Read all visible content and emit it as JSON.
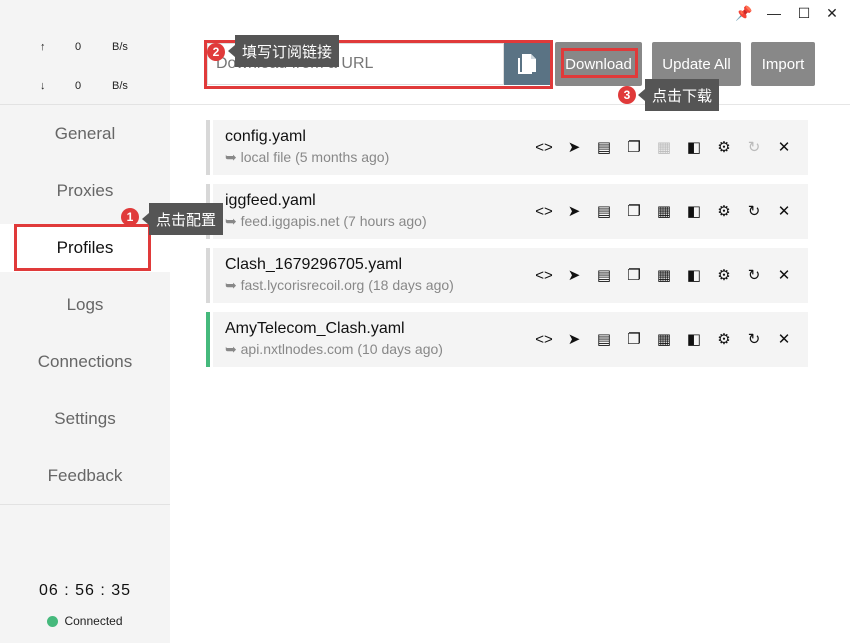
{
  "window": {
    "pin": "📌",
    "minimize": "—",
    "maximize": "☐",
    "close": "✕"
  },
  "traffic": {
    "up": {
      "arrow": "↑",
      "value": "0",
      "unit": "B/s"
    },
    "down": {
      "arrow": "↓",
      "value": "0",
      "unit": "B/s"
    }
  },
  "sidebar": {
    "items": [
      {
        "label": "General"
      },
      {
        "label": "Proxies"
      },
      {
        "label": "Profiles"
      },
      {
        "label": "Logs"
      },
      {
        "label": "Connections"
      },
      {
        "label": "Settings"
      },
      {
        "label": "Feedback"
      }
    ],
    "active": "Profiles",
    "clock": "06 : 56 : 35",
    "status": "Connected",
    "status_color": "#45b97c"
  },
  "header": {
    "url_placeholder": "Download from a URL",
    "download_label": "Download",
    "update_all_label": "Update All",
    "import_label": "Import"
  },
  "annotations": [
    {
      "number": "1",
      "text": "点击配置"
    },
    {
      "number": "2",
      "text": "填写订阅链接"
    },
    {
      "number": "3",
      "text": "点击下载"
    }
  ],
  "profiles": [
    {
      "name": "config.yaml",
      "source": "➥ local file (5 months ago)",
      "active": false
    },
    {
      "name": "iggfeed.yaml",
      "source": "➥ feed.iggapis.net (7 hours ago)",
      "active": false
    },
    {
      "name": "Clash_1679296705.yaml",
      "source": "➥ fast.lycorisrecoil.org (18 days ago)",
      "active": false
    },
    {
      "name": "AmyTelecom_Clash.yaml",
      "source": "➥ api.nxtlnodes.com (10 days ago)",
      "active": true
    }
  ],
  "colors": {
    "accent": "#45b97c",
    "annotation": "#e03a3a",
    "button": "#888888",
    "paste_button": "#5a7384"
  }
}
